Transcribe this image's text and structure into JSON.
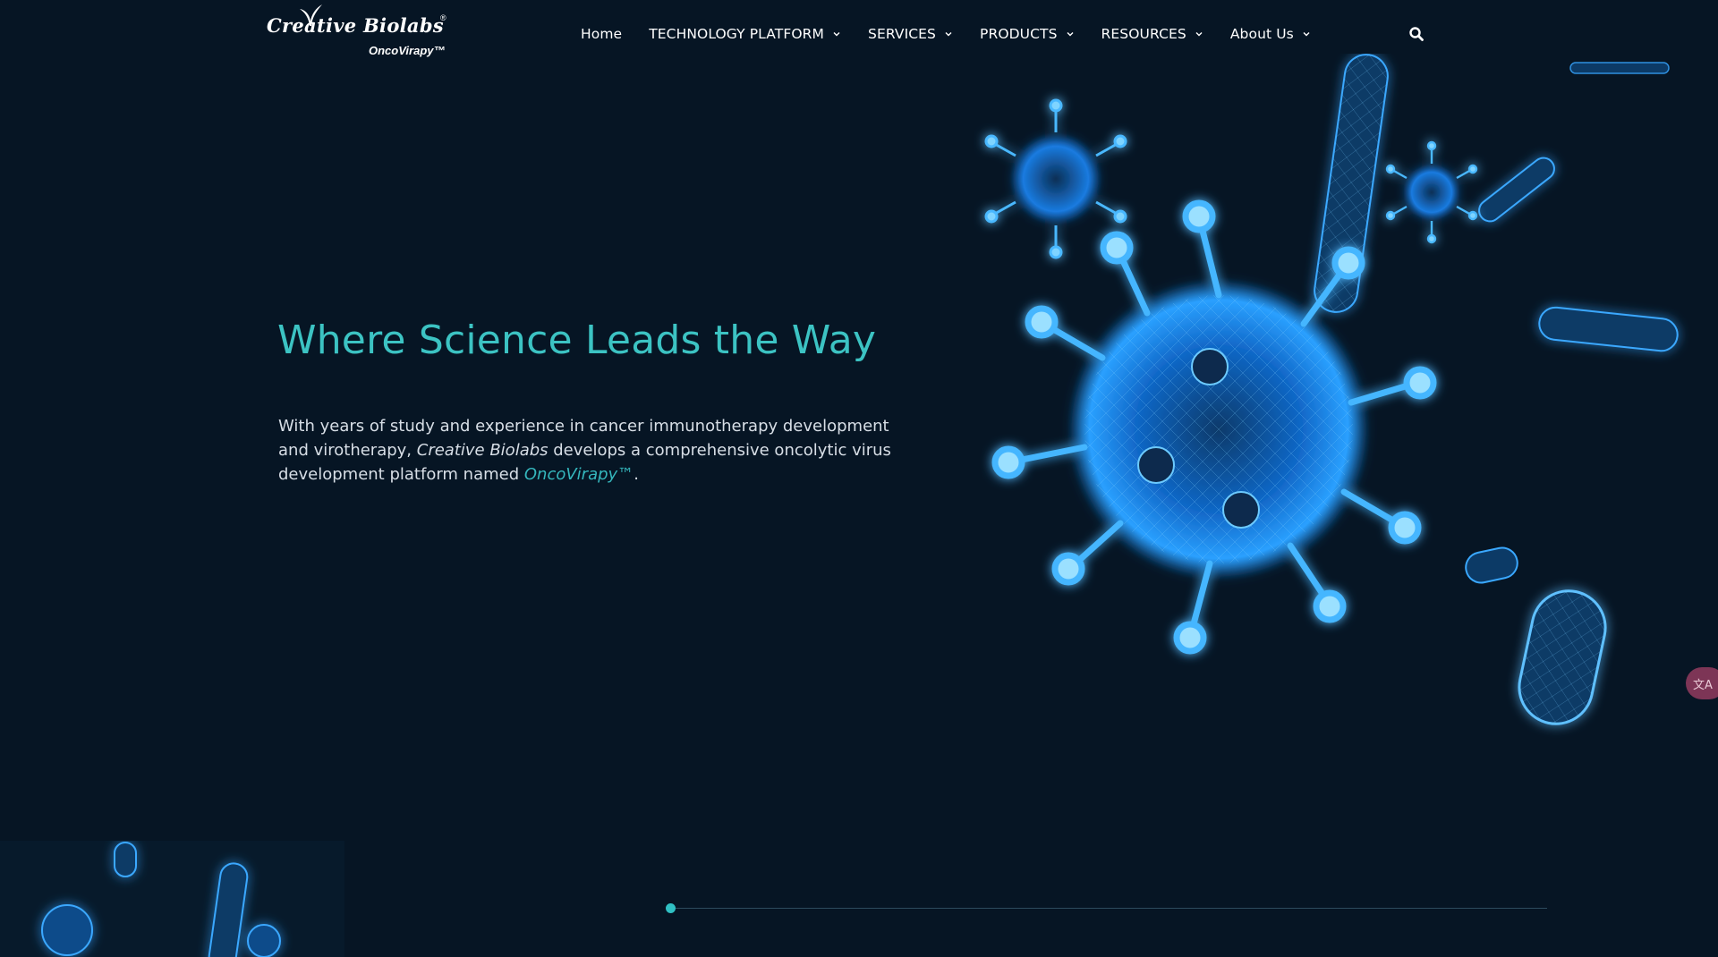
{
  "header": {
    "logo": {
      "brand": "Creative Biolabs",
      "registered": "®",
      "product": "OncoVirapy™"
    },
    "nav": [
      {
        "label": "Home",
        "has_dropdown": false
      },
      {
        "label": "TECHNOLOGY PLATFORM",
        "has_dropdown": true
      },
      {
        "label": "SERVICES",
        "has_dropdown": true
      },
      {
        "label": "PRODUCTS",
        "has_dropdown": true
      },
      {
        "label": "RESOURCES",
        "has_dropdown": true
      },
      {
        "label": "About Us",
        "has_dropdown": true
      }
    ],
    "search_icon": "search-icon"
  },
  "hero": {
    "title": "Where Science Leads the Way",
    "description": {
      "part1": "With years of study and experience in cancer immunotherapy development and virotherapy, ",
      "company": "Creative Biolabs",
      "part2": " develops a comprehensive oncolytic virus development platform named ",
      "product": "OncoVirapy™",
      "part3": "."
    }
  },
  "slider": {
    "current": 1,
    "total": 1
  },
  "translate_icon": "translate-icon",
  "colors": {
    "background": "#061524",
    "accent": "#3cc3c3",
    "text": "#d7dee6",
    "virus_glow": "#1e90ff"
  }
}
